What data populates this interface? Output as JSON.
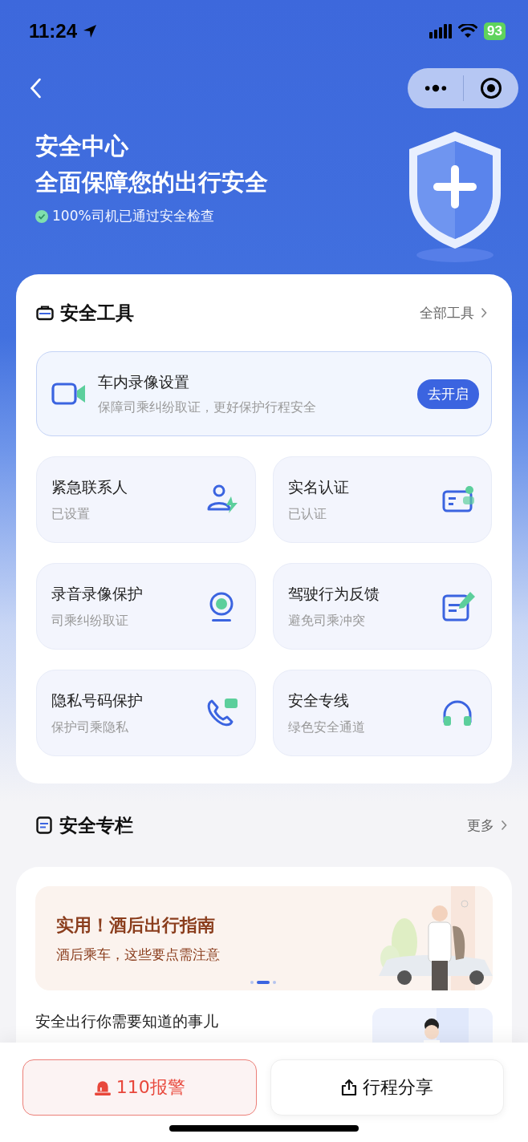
{
  "status_bar": {
    "time": "11:24",
    "battery": "93"
  },
  "header": {
    "title": "安全中心",
    "subtitle": "全面保障您的出行安全",
    "note": "100%司机已通过安全检查"
  },
  "tools": {
    "title": "安全工具",
    "more": "全部工具",
    "banner": {
      "title": "车内录像设置",
      "desc": "保障司乘纠纷取证，更好保护行程安全",
      "button": "去开启"
    },
    "items": [
      {
        "title": "紧急联系人",
        "subtitle": "已设置"
      },
      {
        "title": "实名认证",
        "subtitle": "已认证"
      },
      {
        "title": "录音录像保护",
        "subtitle": "司乘纠纷取证"
      },
      {
        "title": "驾驶行为反馈",
        "subtitle": "避免司乘冲突"
      },
      {
        "title": "隐私号码保护",
        "subtitle": "保护司乘隐私"
      },
      {
        "title": "安全专线",
        "subtitle": "绿色安全通道"
      }
    ]
  },
  "column": {
    "title": "安全专栏",
    "more": "更多",
    "slide": {
      "title": "实用！酒后出行指南",
      "subtitle": "酒后乘车，这些要点需注意"
    },
    "dots": [
      {
        "selected": false
      },
      {
        "selected": true
      },
      {
        "selected": false
      }
    ],
    "article": {
      "title": "安全出行你需要知道的事儿"
    }
  },
  "actions": [
    {
      "kind": "alarm",
      "label": "110报警"
    },
    {
      "kind": "share",
      "label": "行程分享"
    }
  ]
}
